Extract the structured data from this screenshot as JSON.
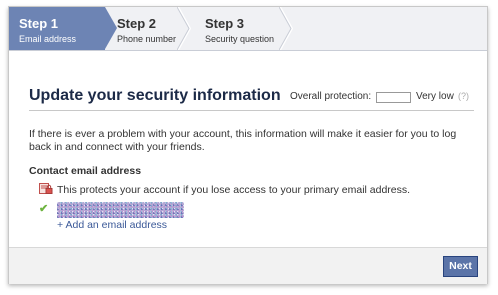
{
  "steps": [
    {
      "label": "Step 1",
      "sub": "Email address",
      "active": true
    },
    {
      "label": "Step 2",
      "sub": "Phone number",
      "active": false
    },
    {
      "label": "Step 3",
      "sub": "Security question",
      "active": false
    }
  ],
  "header": {
    "title": "Update your security information",
    "protection_label": "Overall protection:",
    "protection_level": "Very low",
    "help": "(?)"
  },
  "body": {
    "intro": "If there is ever a problem with your account, this information will make it easier for you to log back in and connect with your friends.",
    "section_title": "Contact email address",
    "protect_note": "This protects your account if you lose access to your primary email address.",
    "add_email": "+ Add an email address"
  },
  "footer": {
    "next_label": "Next"
  },
  "colors": {
    "accent": "#6d84b4",
    "link": "#3b5998",
    "button": "#5b74a8",
    "check": "#6db33f"
  },
  "icons": {
    "protect": "lock-icon",
    "verified": "checkmark-icon"
  }
}
